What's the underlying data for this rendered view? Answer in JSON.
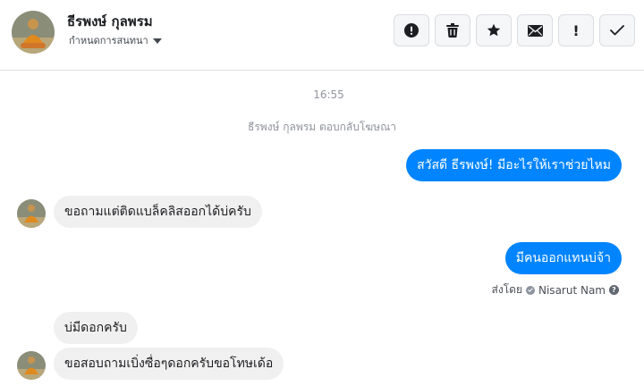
{
  "header": {
    "contact_name": "ธีรพงษ์ กุลพรม",
    "assign_label": "กำหนดการสนทนา",
    "toolbar": [
      {
        "icon": "alert-circle-icon"
      },
      {
        "icon": "trash-icon"
      },
      {
        "icon": "star-icon"
      },
      {
        "icon": "envelope-icon"
      },
      {
        "icon": "exclamation-icon",
        "glyph": "!"
      },
      {
        "icon": "checkmark-icon"
      }
    ]
  },
  "conversation": {
    "timestamp": "16:55",
    "system_note": "ธีรพงษ์ กุลพรม ตอบกลับโฆษณา",
    "messages": [
      {
        "direction": "outgoing",
        "text": "สวัสดี ธีรพงษ์! มีอะไรให้เราช่วยไหม"
      },
      {
        "direction": "incoming",
        "text": "ขอถามแต่ติดแบล็คลิสออกได้บ่ครับ"
      },
      {
        "direction": "outgoing",
        "text": "มีคนออกแทนบ่จ้า"
      },
      {
        "direction": "incoming",
        "text": "บ่มีดอกครับ"
      },
      {
        "direction": "incoming",
        "text": "ขอสอบถามเบิ่งซื่อๆดอกครับขอโทษเด้อ"
      }
    ],
    "sent_by": {
      "label": "ส่งโดย",
      "name": "Nisarut Nam",
      "help": "?"
    }
  },
  "colors": {
    "outgoing_bubble": "#0084ff",
    "incoming_bubble": "#f1f0f0",
    "meta_text": "#90949c"
  }
}
